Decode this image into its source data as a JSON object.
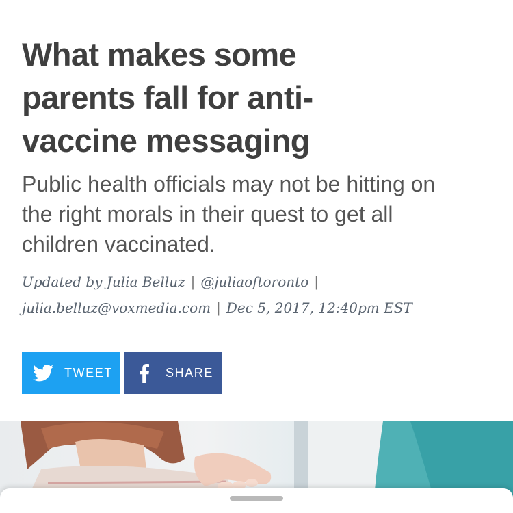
{
  "article": {
    "headline": "What makes some parents fall for anti-vaccine messaging",
    "dek": "Public health officials may not be hitting on the right morals in their quest to get all children vaccinated.",
    "byline": {
      "prefix": "Updated by",
      "author": "Julia Belluz",
      "twitter": "@juliaoftoronto",
      "email": "julia.belluz@voxmedia.com",
      "date": "Dec 5, 2017, 12:40pm EST"
    }
  },
  "share": {
    "tweet_label": "TWEET",
    "share_label": "SHARE",
    "tweet_icon": "twitter-bird-icon",
    "share_icon": "facebook-icon",
    "tweet_color": "#1da1f2",
    "share_color": "#3b5998"
  },
  "colors": {
    "headline": "#3f3f3f",
    "dek": "#555555",
    "byline": "#5a6470"
  }
}
